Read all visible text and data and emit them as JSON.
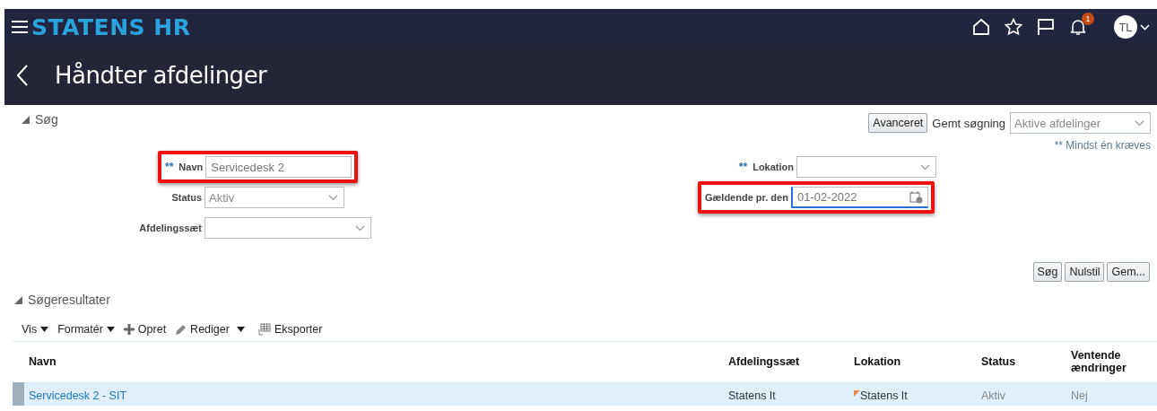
{
  "header": {
    "brand": "STATENS HR",
    "notification_count": "1",
    "avatar": "TL"
  },
  "page_title": "Håndter afdelinger",
  "search": {
    "section_label": "Søg",
    "advanced_button": "Avanceret",
    "saved_search_label": "Gemt søgning",
    "saved_search": "Aktive afdelinger",
    "required_note": "** Mindst én kræves",
    "left_fields": [
      {
        "kind": "text",
        "label": "Navn",
        "required": true,
        "highlighted": true,
        "value": "Servicedesk 2"
      },
      {
        "kind": "select",
        "label": "Status",
        "required": false,
        "highlighted": false,
        "value": "Aktiv"
      },
      {
        "kind": "select",
        "label": "Afdelingssæt",
        "required": false,
        "highlighted": false
      }
    ],
    "right_fields": [
      {
        "kind": "select",
        "label": "Lokation",
        "required": true,
        "highlighted": false
      },
      {
        "kind": "date",
        "label": "Gældende pr. den",
        "required": false,
        "highlighted": true,
        "value": "01-02-2022"
      }
    ],
    "required_mark": "**",
    "buttons": [
      "Søg",
      "Nulstil",
      "Gem..."
    ]
  },
  "results": {
    "section_label": "Søgeresultater",
    "toolbar": [
      {
        "kind": "menu",
        "label": "Vis"
      },
      {
        "kind": "menu",
        "label": "Formatér"
      },
      {
        "kind": "create",
        "label": "Opret"
      },
      {
        "kind": "edit",
        "label": "Rediger"
      },
      {
        "kind": "export",
        "label": "Eksporter"
      }
    ],
    "columns": [
      "Navn",
      "Afdelingssæt",
      "Lokation",
      "Status",
      "Ventende ændringer"
    ],
    "rows": [
      {
        "selected": true,
        "name": "Servicedesk 2 - SIT",
        "set": "Statens It",
        "location": "Statens It",
        "location_flagged": true,
        "status": "Aktiv",
        "pending": "Nej"
      }
    ]
  }
}
